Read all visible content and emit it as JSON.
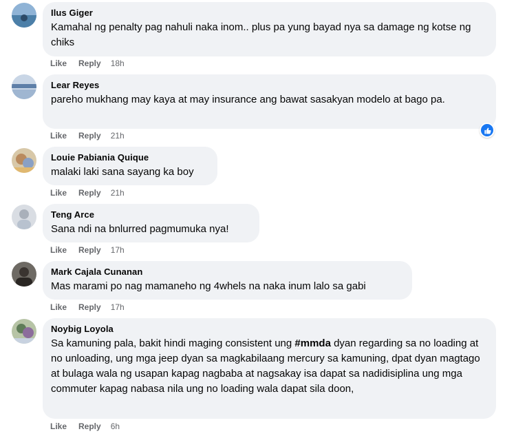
{
  "comments": [
    {
      "name": "Ilus Giger",
      "text": "Kamahal ng penalty pag nahuli naka inom.. plus pa yung bayad nya sa damage ng kotse ng chiks",
      "like": "Like",
      "reply": "Reply",
      "time": "18h"
    },
    {
      "name": "Lear Reyes",
      "text": "pareho mukhang may kaya at may insurance ang bawat sasakyan modelo at bago pa.",
      "like": "Like",
      "reply": "Reply",
      "time": "21h",
      "reaction": "like-icon"
    },
    {
      "name": "Louie Pabiania Quique",
      "text": "malaki laki sana sayang ka boy",
      "like": "Like",
      "reply": "Reply",
      "time": "21h"
    },
    {
      "name": "Teng Arce",
      "text": "Sana ndi na bnlurred pagmumuka nya!",
      "like": "Like",
      "reply": "Reply",
      "time": "17h"
    },
    {
      "name": "Mark Cajala Cunanan",
      "text": "Mas marami po nag mamaneho ng 4whels na naka inum lalo sa gabi",
      "like": "Like",
      "reply": "Reply",
      "time": "17h"
    },
    {
      "name": "Noybig Loyola",
      "text_before": "Sa kamuning pala, bakit hindi maging consistent ung ",
      "hashtag": "#mmda",
      "text_after": " dyan regarding sa no loading at no unloading, ung mga jeep dyan sa magkabilaang mercury sa kamuning, dpat dyan magtago at bulaga wala ng usapan kapag nagbaba at nagsakay isa dapat sa nadidisiplina ung mga commuter kapag nabasa nila ung no loading wala dapat sila doon,",
      "like": "Like",
      "reply": "Reply",
      "time": "6h"
    }
  ],
  "colors": {
    "bubble": "#f0f2f5",
    "meta": "#65676b",
    "text": "#050505",
    "reaction": "#1877f2"
  }
}
